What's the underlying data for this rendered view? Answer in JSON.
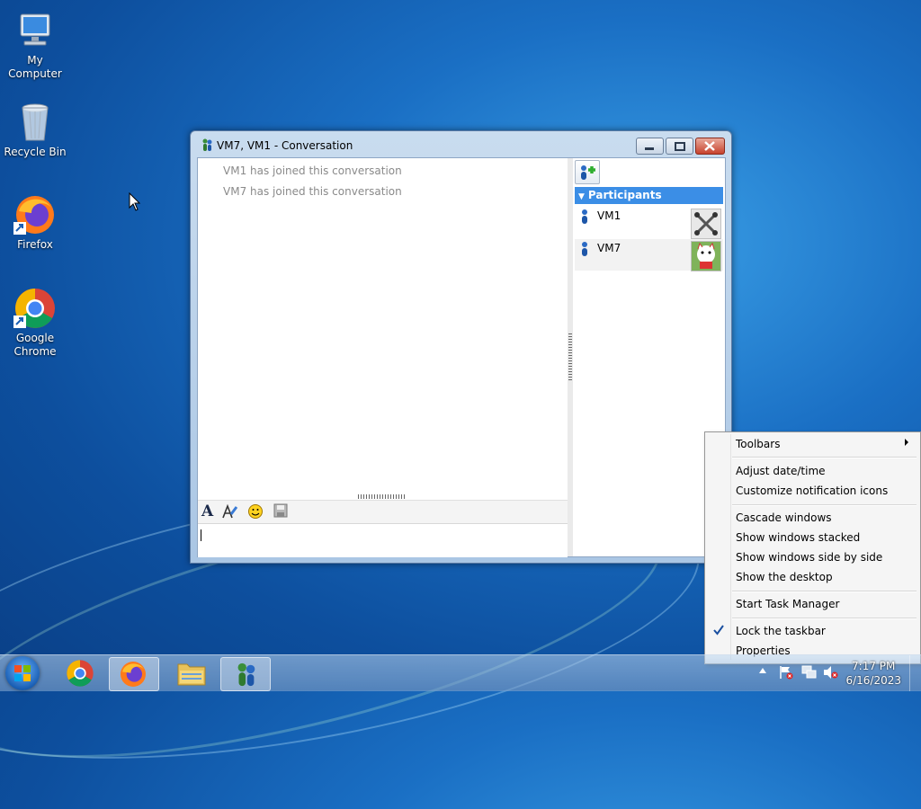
{
  "desktop": {
    "icons": [
      {
        "label": "My Computer",
        "icon": "computer-icon"
      },
      {
        "label": "Recycle Bin",
        "icon": "recycle-bin-icon"
      },
      {
        "label": "Firefox",
        "icon": "firefox-icon"
      },
      {
        "label": "Google Chrome",
        "icon": "chrome-icon"
      }
    ]
  },
  "window": {
    "title": "VM7, VM1 - Conversation",
    "messages": [
      "VM1 has joined this conversation",
      "VM7 has joined this conversation"
    ],
    "participants_header": "Participants",
    "participants": [
      {
        "name": "VM1",
        "avatar": "avatar-vm1-icon"
      },
      {
        "name": "VM7",
        "avatar": "avatar-vm7-icon"
      }
    ],
    "input_value": ""
  },
  "context_menu": {
    "items": [
      "Toolbars",
      "Adjust date/time",
      "Customize notification icons",
      "Cascade windows",
      "Show windows stacked",
      "Show windows side by side",
      "Show the desktop",
      "Start Task Manager",
      "Lock the taskbar",
      "Properties"
    ],
    "checked": "Lock the taskbar"
  },
  "taskbar": {
    "time": "7:17 PM",
    "date": "6/16/2023"
  },
  "colors": {
    "desktop_blue": "#1a6fc4",
    "selection_blue": "#3b8ee6"
  }
}
